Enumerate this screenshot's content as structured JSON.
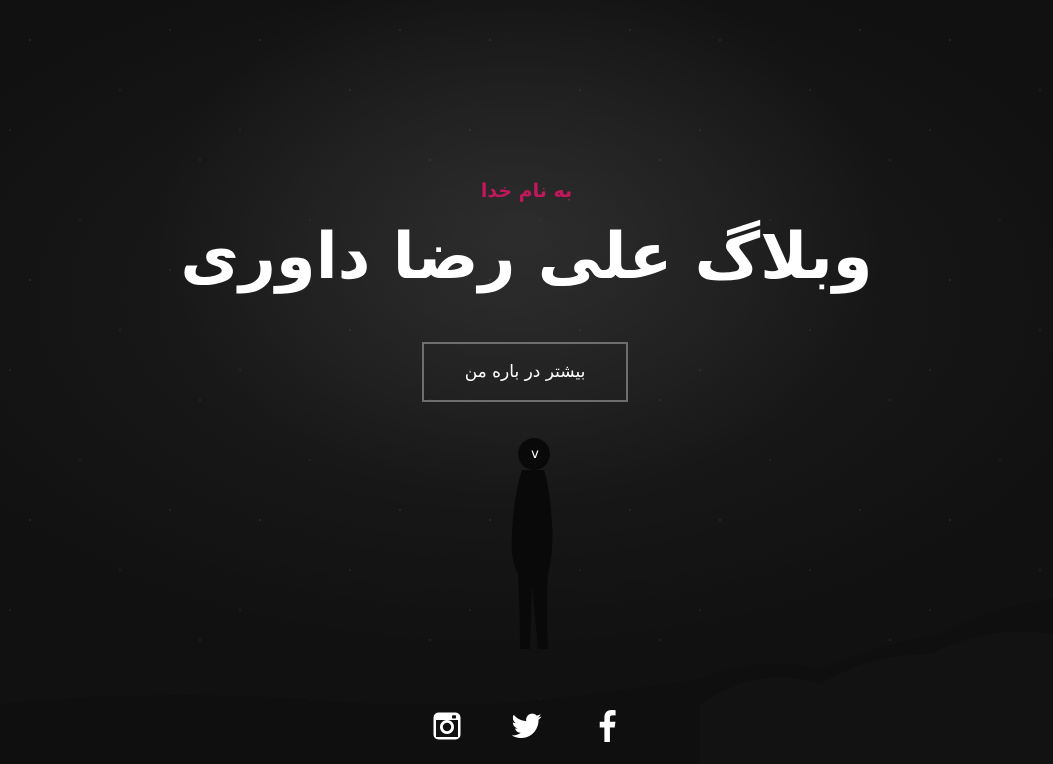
{
  "hero": {
    "greeting": "به نام خدا",
    "title": "وبلاگ علی رضا داوری",
    "about_button": "بیشتر در باره من",
    "scroll_indicator": "v"
  },
  "social": [
    {
      "icon": "instagram-icon"
    },
    {
      "icon": "twitter-icon"
    },
    {
      "icon": "facebook-icon"
    }
  ],
  "colors": {
    "accent": "#c2185b",
    "text": "#ffffff",
    "button_border": "#6e6e6e",
    "background": "#111111"
  }
}
